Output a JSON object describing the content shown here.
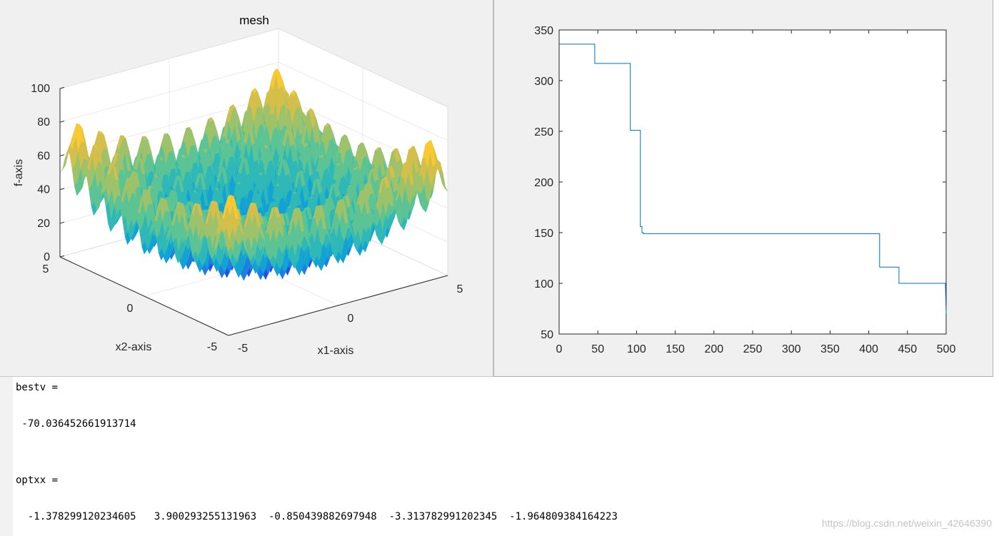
{
  "figure1": {
    "title": "mesh",
    "xlabel": "x1-axis",
    "ylabel": "x2-axis",
    "zlabel": "f-axis",
    "zticks": [
      "0",
      "20",
      "40",
      "60",
      "80",
      "100"
    ],
    "x1ticks": [
      "-5",
      "0",
      "5"
    ],
    "x2ticks": [
      "-5",
      "0",
      "5"
    ]
  },
  "chart_data": {
    "type": "line",
    "xlim": [
      0,
      500
    ],
    "ylim": [
      50,
      350
    ],
    "xticks": [
      "0",
      "50",
      "100",
      "150",
      "200",
      "250",
      "300",
      "350",
      "400",
      "450",
      "500"
    ],
    "yticks": [
      "50",
      "100",
      "150",
      "200",
      "250",
      "300",
      "350"
    ],
    "series": [
      {
        "color": "#0072bd",
        "points": [
          [
            0,
            336
          ],
          [
            46,
            336
          ],
          [
            46,
            317
          ],
          [
            92,
            317
          ],
          [
            92,
            251
          ],
          [
            105,
            251
          ],
          [
            105,
            156
          ],
          [
            107,
            156
          ],
          [
            107,
            150
          ],
          [
            109,
            150
          ],
          [
            109,
            149
          ],
          [
            414,
            149
          ],
          [
            414,
            116
          ],
          [
            439,
            116
          ],
          [
            439,
            100
          ],
          [
            499,
            100
          ],
          [
            500,
            70
          ]
        ]
      }
    ]
  },
  "console": {
    "lines": [
      {
        "text": "bestv =",
        "top": 7
      },
      {
        "text": " -70.036452661913714",
        "top": 58
      },
      {
        "text": "optxx =",
        "top": 137
      },
      {
        "text": "  -1.378299120234605   3.900293255131963  -0.850439882697948  -3.313782991202345  -1.964809384164223",
        "top": 188
      }
    ]
  },
  "watermark": "https://blog.csdn.net/weixin_42646390",
  "colors": {
    "plot_line": "#0072bd",
    "figure_bg": "#f0f0f0"
  }
}
